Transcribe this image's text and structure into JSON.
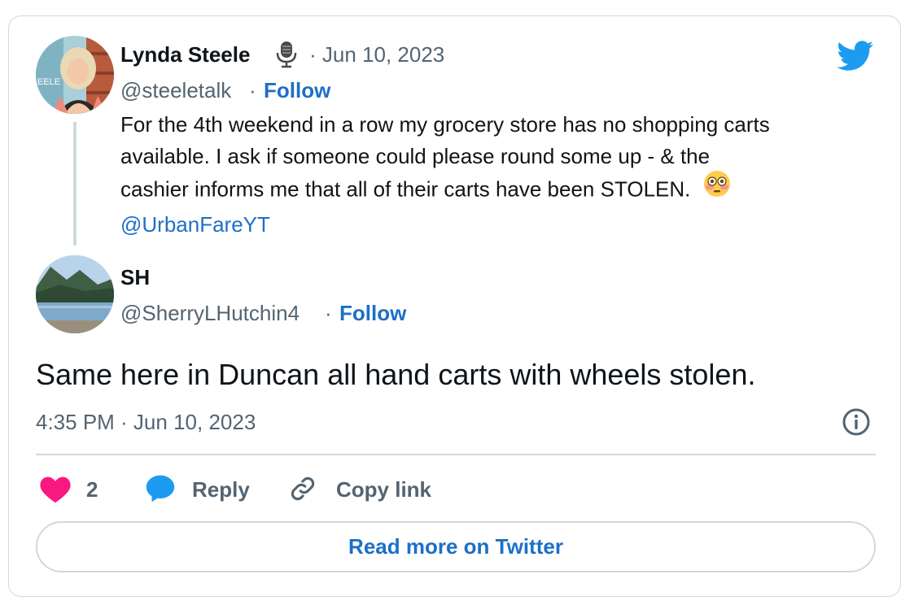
{
  "colors": {
    "link": "#1d6fc7",
    "twitter_blue": "#1d9bf0",
    "muted": "#536471",
    "text": "#0f1419",
    "border": "#cfd9de",
    "heart": "#f91880"
  },
  "parent_tweet": {
    "author_name": "Lynda Steele",
    "badge_icon": "microphone-icon",
    "date": "· Jun 10, 2023",
    "handle": "@steeletalk",
    "separator": "·",
    "follow_label": "Follow",
    "text_lines": [
      "For the 4th weekend in a row my grocery store has no shopping carts",
      "available.  I ask if someone could please round some up - & the",
      "cashier informs me that all of their carts have been STOLEN.  "
    ],
    "emoji": "flushed-face-emoji",
    "mention": "@UrbanFareYT"
  },
  "reply_tweet": {
    "author_name": "SH",
    "handle": "@SherryLHutchin4",
    "separator": "·",
    "follow_label": "Follow",
    "text": "Same here in Duncan all hand carts with wheels stolen.",
    "timestamp": "4:35 PM · Jun 10, 2023"
  },
  "actions": {
    "like_count": "2",
    "reply_label": "Reply",
    "copy_link_label": "Copy link"
  },
  "read_more_label": "Read more on Twitter",
  "icons": {
    "brand": "twitter-bird-icon",
    "info": "info-icon",
    "like": "heart-icon",
    "reply": "speech-bubble-icon",
    "copy": "link-icon"
  }
}
